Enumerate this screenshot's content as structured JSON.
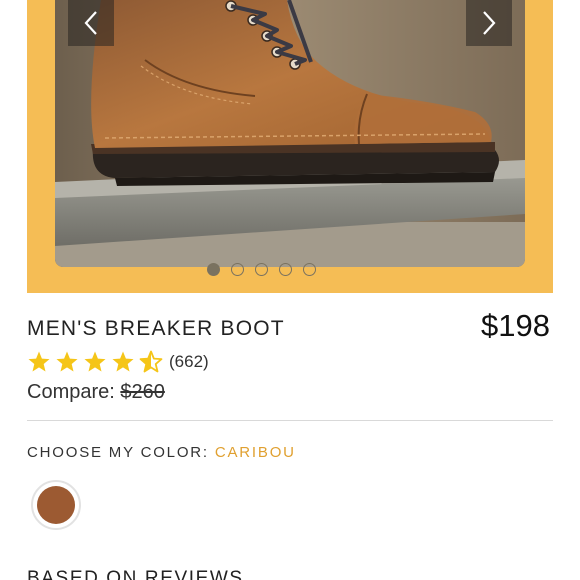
{
  "carousel": {
    "prev_icon": "chevron-left-icon",
    "next_icon": "chevron-right-icon",
    "slides": 5,
    "active_slide": 1,
    "image_subject": "brown leather cap-toe lace-up boot on a stone block",
    "frame_color": "#f5bd55"
  },
  "product": {
    "title": "MEN'S BREAKER BOOT",
    "price": "$198",
    "rating": 4.5,
    "rating_count": "(662)",
    "compare_label": "Compare: ",
    "compare_price": "$260"
  },
  "color": {
    "label": "CHOOSE MY COLOR: ",
    "selected": "CARIBOU",
    "selected_color": "#e0a030",
    "swatch_color": "#9c5a32"
  },
  "reviews": {
    "heading": "BASED ON REVIEWS"
  },
  "colors": {
    "star": "#f5c518"
  }
}
